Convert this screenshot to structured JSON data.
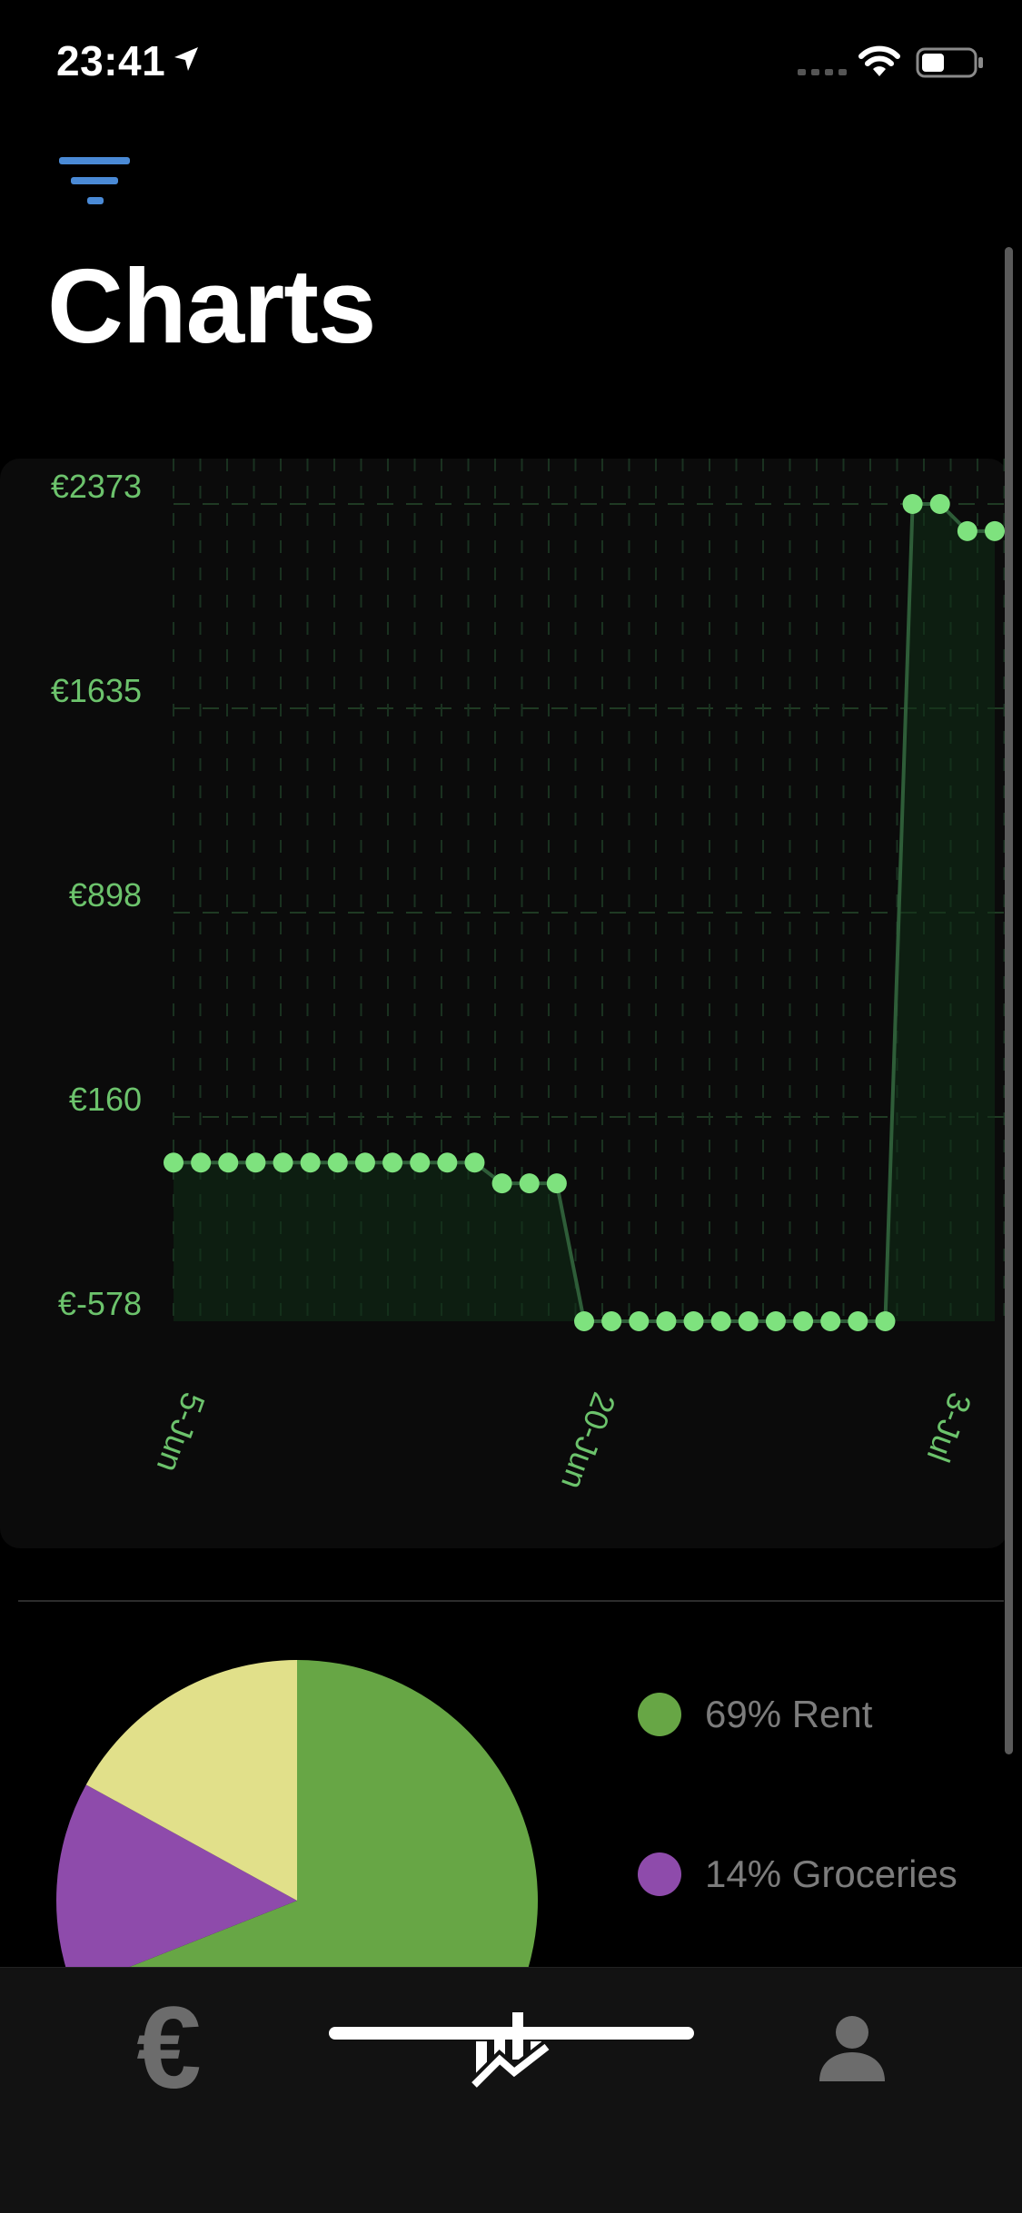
{
  "status_bar": {
    "time": "23:41",
    "icons": [
      "location-arrow-icon",
      "signal-icon",
      "wifi-icon",
      "battery-icon"
    ]
  },
  "header": {
    "filter_icon": "filter-icon",
    "title": "Charts"
  },
  "colors": {
    "accent_green": "#7ee27e",
    "label_green": "#6cc36c",
    "filter_blue": "#4a8ad6",
    "rent": "#67a645",
    "groceries": "#8e4bab",
    "other": "#e1e08a"
  },
  "chart_data": [
    {
      "type": "line",
      "title": "",
      "xlabel": "",
      "ylabel": "",
      "x_tick_labels": [
        "5-Jun",
        "20-Jun",
        "3-Jul"
      ],
      "y_tick_labels": [
        "€2373",
        "€1635",
        "€898",
        "€160",
        "€-578"
      ],
      "ylim": [
        -578,
        2373
      ],
      "grid": true,
      "x": [
        "5-Jun",
        "6-Jun",
        "7-Jun",
        "8-Jun",
        "9-Jun",
        "10-Jun",
        "11-Jun",
        "12-Jun",
        "13-Jun",
        "14-Jun",
        "15-Jun",
        "16-Jun",
        "17-Jun",
        "18-Jun",
        "19-Jun",
        "20-Jun",
        "21-Jun",
        "22-Jun",
        "23-Jun",
        "24-Jun",
        "25-Jun",
        "26-Jun",
        "27-Jun",
        "28-Jun",
        "29-Jun",
        "30-Jun",
        "1-Jul",
        "2-Jul",
        "3-Jul",
        "4-Jul",
        "5-Jul"
      ],
      "values": [
        -5,
        -5,
        -5,
        -5,
        -5,
        -5,
        -5,
        -5,
        -5,
        -5,
        -5,
        -5,
        -80,
        -80,
        -80,
        -578,
        -578,
        -578,
        -578,
        -578,
        -578,
        -578,
        -578,
        -578,
        -578,
        -578,
        -578,
        2373,
        2373,
        2275,
        2275
      ]
    },
    {
      "type": "pie",
      "slices": [
        {
          "label": "Rent",
          "percent": 69,
          "color": "#67a645"
        },
        {
          "label": "Groceries",
          "percent": 14,
          "color": "#8e4bab"
        },
        {
          "label": "",
          "percent": 17,
          "color": "#e1e08a"
        }
      ]
    }
  ],
  "legend": [
    {
      "text": "69% Rent",
      "color": "#67a645"
    },
    {
      "text": "14% Groceries",
      "color": "#8e4bab"
    }
  ],
  "tab_bar": {
    "tabs": [
      {
        "icon": "euro-icon",
        "glyph": "€",
        "selected": false
      },
      {
        "icon": "charts-icon",
        "selected": true
      },
      {
        "icon": "person-icon",
        "selected": false
      }
    ]
  }
}
